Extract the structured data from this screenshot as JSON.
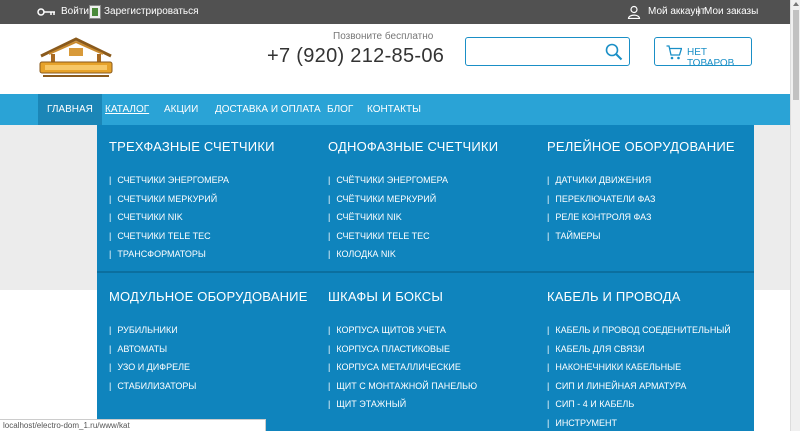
{
  "topbar": {
    "login": "Войти",
    "register": "Зарегистрироваться",
    "account": "Мой аккаунт",
    "separator": "|",
    "orders": "Мои заказы"
  },
  "header": {
    "call_label": "Позвоните бесплатно",
    "phone": "+7 (920) 212-85-06",
    "search_value": "",
    "cart_label": "НЕТ ТОВАРОВ"
  },
  "nav": [
    {
      "label": "ГЛАВНАЯ"
    },
    {
      "label": "КАТАЛОГ"
    },
    {
      "label": "АКЦИИ"
    },
    {
      "label": "ДОСТАВКА И ОПЛАТА"
    },
    {
      "label": "БЛОГ"
    },
    {
      "label": "КОНТАКТЫ"
    }
  ],
  "dropdown": {
    "columns": [
      {
        "title": "ТРЕХФАЗНЫЕ СЧЕТЧИКИ",
        "items": [
          "СЧЕТЧИКИ ЭНЕРГОМЕРА",
          "СЧЕТЧИКИ МЕРКУРИЙ",
          "СЧЕТЧИКИ NIK",
          "СЧЕТЧИКИ TELE TEC",
          "ТРАНСФОРМАТОРЫ"
        ]
      },
      {
        "title": "ОДНОФАЗНЫЕ СЧЕТЧИКИ",
        "items": [
          "СЧЁТЧИКИ ЭНЕРГОМЕРА",
          "СЧЁТЧИКИ МЕРКУРИЙ",
          "СЧЁТЧИКИ NIK",
          "СЧЕТЧИКИ TELE TEC",
          "КОЛОДКА NIK"
        ]
      },
      {
        "title": "РЕЛЕЙНОЕ ОБОРУДОВАНИЕ",
        "items": [
          "ДАТЧИКИ ДВИЖЕНИЯ",
          "ПЕРЕКЛЮЧАТЕЛИ ФАЗ",
          "РЕЛЕ КОНТРОЛЯ ФАЗ",
          "ТАЙМЕРЫ"
        ]
      },
      {
        "title": "МОДУЛЬНОЕ ОБОРУДОВАНИЕ",
        "items": [
          "РУБИЛЬНИКИ",
          "АВТОМАТЫ",
          "УЗО И ДИФРЕЛЕ",
          "СТАБИЛИЗАТОРЫ"
        ]
      },
      {
        "title": "ШКАФЫ И БОКСЫ",
        "items": [
          "КОРПУСА ЩИТОВ УЧЕТА",
          "КОРПУСА ПЛАСТИКОВЫЕ",
          "КОРПУСА МЕТАЛЛИЧЕСКИЕ",
          "ЩИТ С МОНТАЖНОЙ ПАНЕЛЬЮ",
          "ЩИТ ЭТАЖНЫЙ"
        ]
      },
      {
        "title": "КАБЕЛЬ И ПРОВОДА",
        "items": [
          "КАБЕЛЬ И ПРОВОД СОЕДЕНИТЕЛЬНЫЙ",
          "КАБЕЛЬ ДЛЯ СВЯЗИ",
          "НАКОНЕЧНИКИ КАБЕЛЬНЫЕ",
          "СИП И ЛИНЕЙНАЯ АРМАТУРА",
          "СИП - 4 И КАБЕЛЬ",
          "ИНСТРУМЕНТ"
        ]
      }
    ]
  },
  "statusbar": {
    "url": "localhost/electro-dom_1.ru/www/kat"
  },
  "colors": {
    "topbar": "#515151",
    "nav": "#2aa3d6",
    "nav_active": "#1b86b7",
    "dropdown": "#0f84bd",
    "accent": "#1a8fc6"
  },
  "icons": {
    "login": "key-icon",
    "register": "register-icon",
    "account": "user-icon",
    "search": "search-icon",
    "cart": "cart-icon",
    "logo": "house-logo"
  }
}
